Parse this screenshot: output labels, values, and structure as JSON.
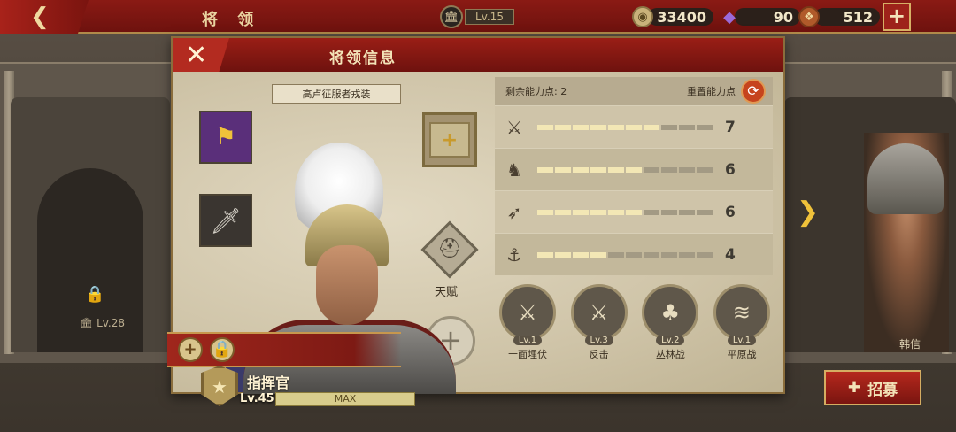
{
  "topbar": {
    "back_icon": "back-arrow-icon",
    "title": "将 领",
    "level": "Lv.15",
    "coins": "33400",
    "gems": "90",
    "food": "512",
    "plus": "+"
  },
  "background": {
    "locked_level": "Lv.28",
    "right_hero_name": "韩信",
    "recruit_label": "招募"
  },
  "panel": {
    "title": "将领信息",
    "close": "✕",
    "outfit_name": "高卢征服者戎装",
    "talent_label": "天赋",
    "rank_name": "指挥官",
    "rank_level": "Lv.45",
    "xp_text": "MAX",
    "stats": {
      "remaining_label": "剩余能力点:",
      "remaining_value": "2",
      "reset_label": "重置能力点",
      "rows": [
        {
          "icon": "sword-icon",
          "value": "7",
          "filled": 7
        },
        {
          "icon": "cavalry-horse-icon",
          "value": "6",
          "filled": 6
        },
        {
          "icon": "bow-icon",
          "value": "6",
          "filled": 6
        },
        {
          "icon": "anchor-icon",
          "value": "4",
          "filled": 4
        }
      ]
    },
    "skills": [
      {
        "icon": "ambush-icon",
        "level": "Lv.1",
        "name": "十面埋伏"
      },
      {
        "icon": "counterattack-icon",
        "level": "Lv.3",
        "name": "反击"
      },
      {
        "icon": "forest-icon",
        "level": "Lv.2",
        "name": "丛林战"
      },
      {
        "icon": "plains-icon",
        "level": "Lv.1",
        "name": "平原战"
      }
    ]
  },
  "colors": {
    "accent_red": "#8a1a14",
    "gold": "#d5ad62",
    "panel_bg": "#c9bea3"
  }
}
